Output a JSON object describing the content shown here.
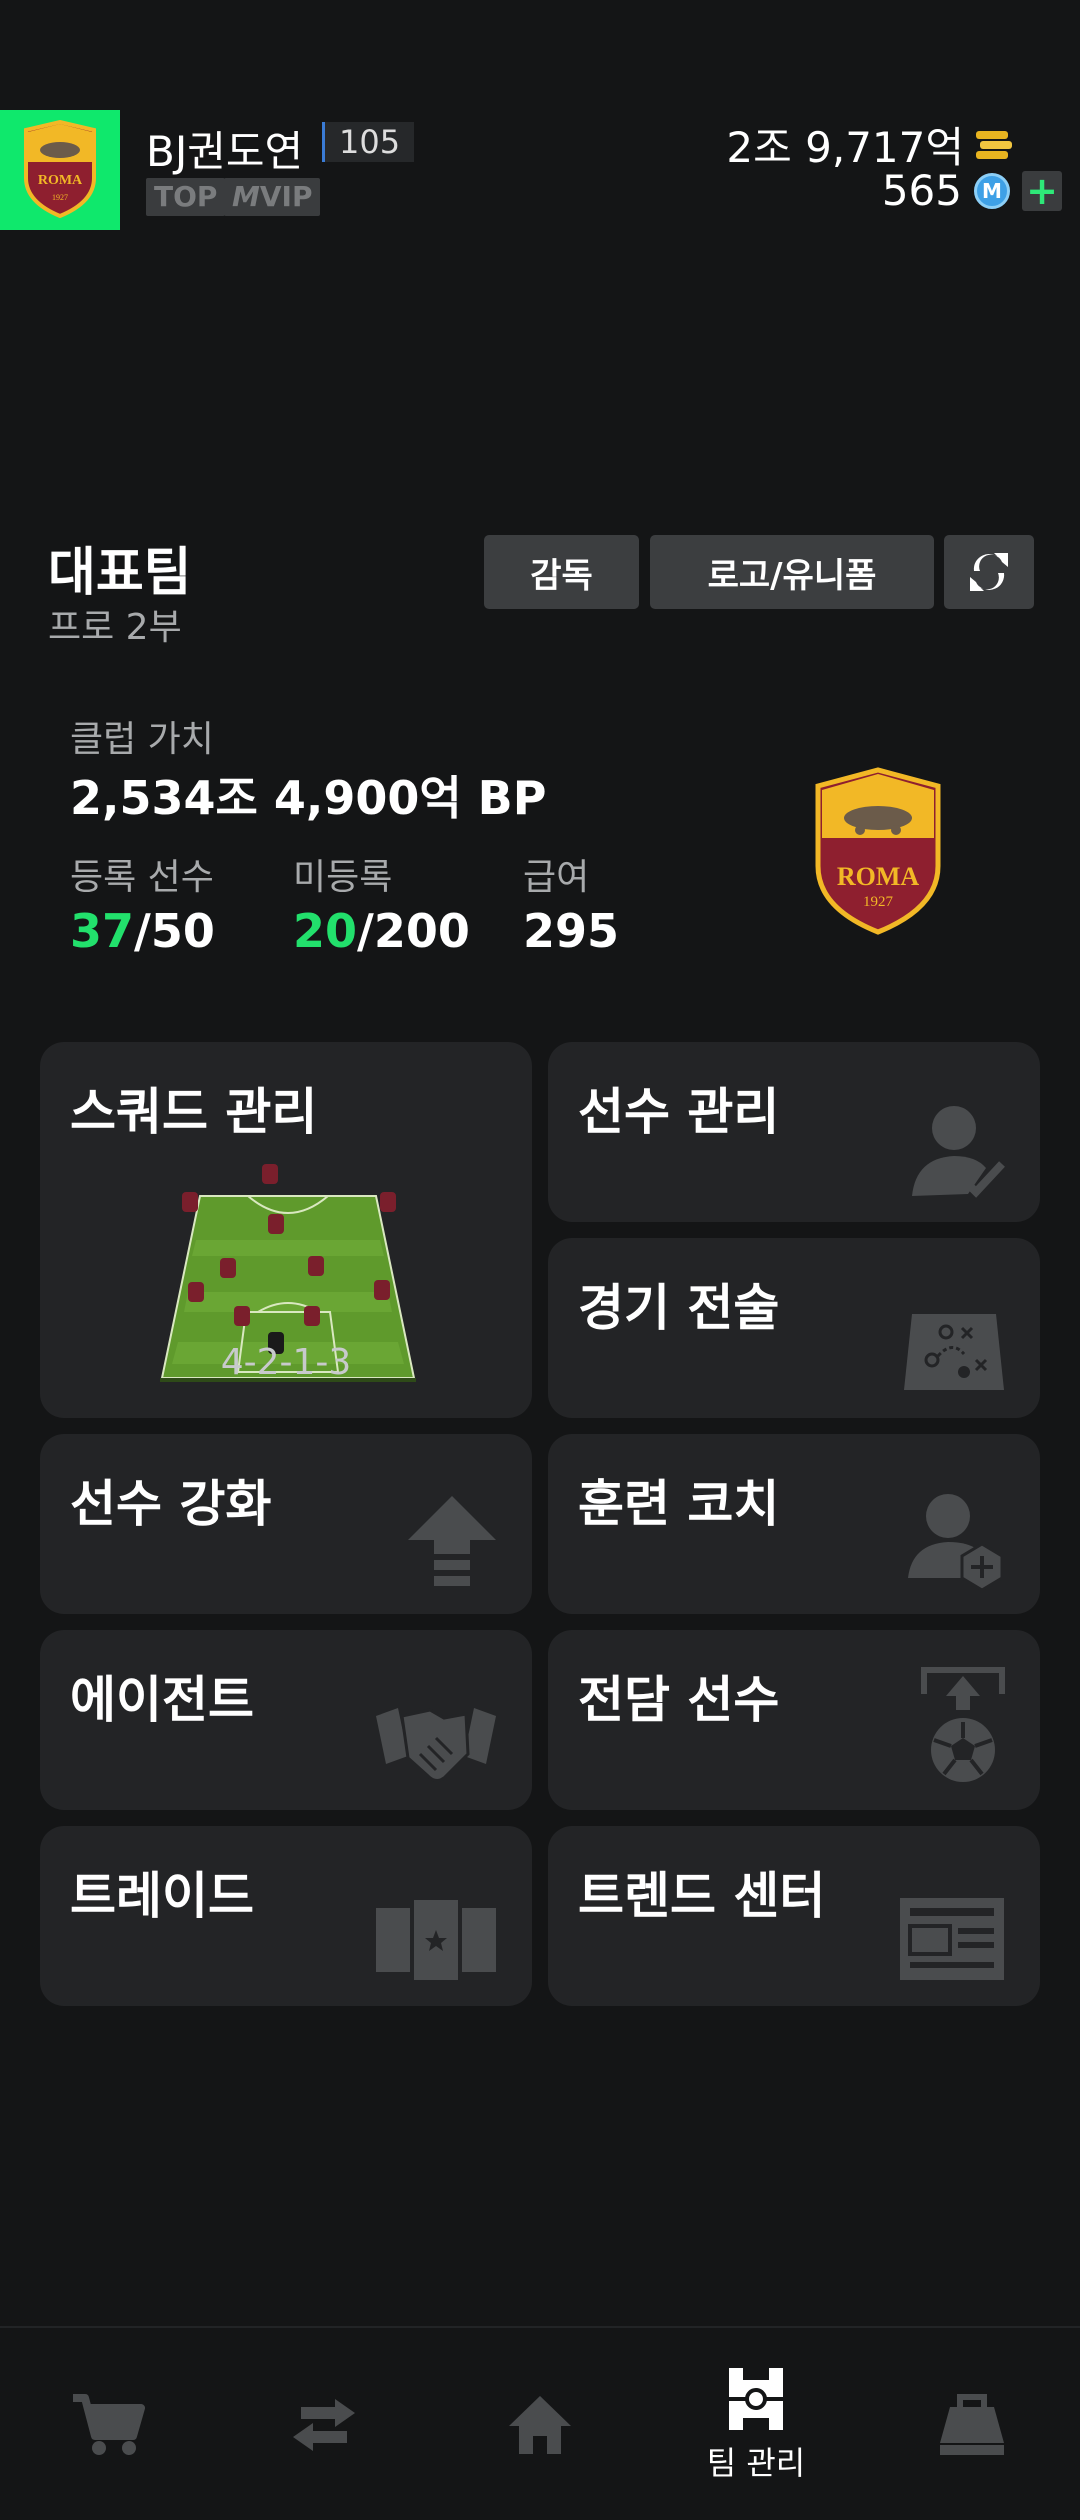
{
  "header": {
    "username": "BJ권도연",
    "level": "105",
    "badges": [
      "TOP",
      "VIP"
    ],
    "badge_prefix": "M",
    "currency_bp": "2조 9,717억",
    "coins": "565",
    "coin_symbol": "M",
    "plus": "+"
  },
  "team": {
    "title": "대표팀",
    "division": "프로 2부",
    "buttons": {
      "coach": "감독",
      "logo_uniform": "로고/유니폼"
    },
    "club_value_label": "클럽 가치",
    "club_value": "2,534조 4,900억 BP",
    "registered_label": "등록 선수",
    "registered_current": "37",
    "registered_max": "/50",
    "unregistered_label": "미등록",
    "unregistered_current": "20",
    "unregistered_max": "/200",
    "salary_label": "급여",
    "salary": "295",
    "crest_text": "ROMA",
    "crest_year": "1927"
  },
  "cards": {
    "squad": "스쿼드 관리",
    "formation": "4-2-1-3",
    "player_mgmt": "선수 관리",
    "tactics": "경기 전술",
    "enhance": "선수 강화",
    "training_coach": "훈련 코치",
    "agent": "에이전트",
    "dedicated": "전담 선수",
    "trade": "트레이드",
    "trend": "트렌드 센터"
  },
  "nav": {
    "team_mgmt": "팀 관리",
    "icons": [
      "cart-icon",
      "transfer-icon",
      "home-icon",
      "team-management-icon",
      "briefcase-icon"
    ]
  },
  "colors": {
    "accent_green": "#22e06c",
    "card_bg": "#232426",
    "bg": "#141516"
  }
}
